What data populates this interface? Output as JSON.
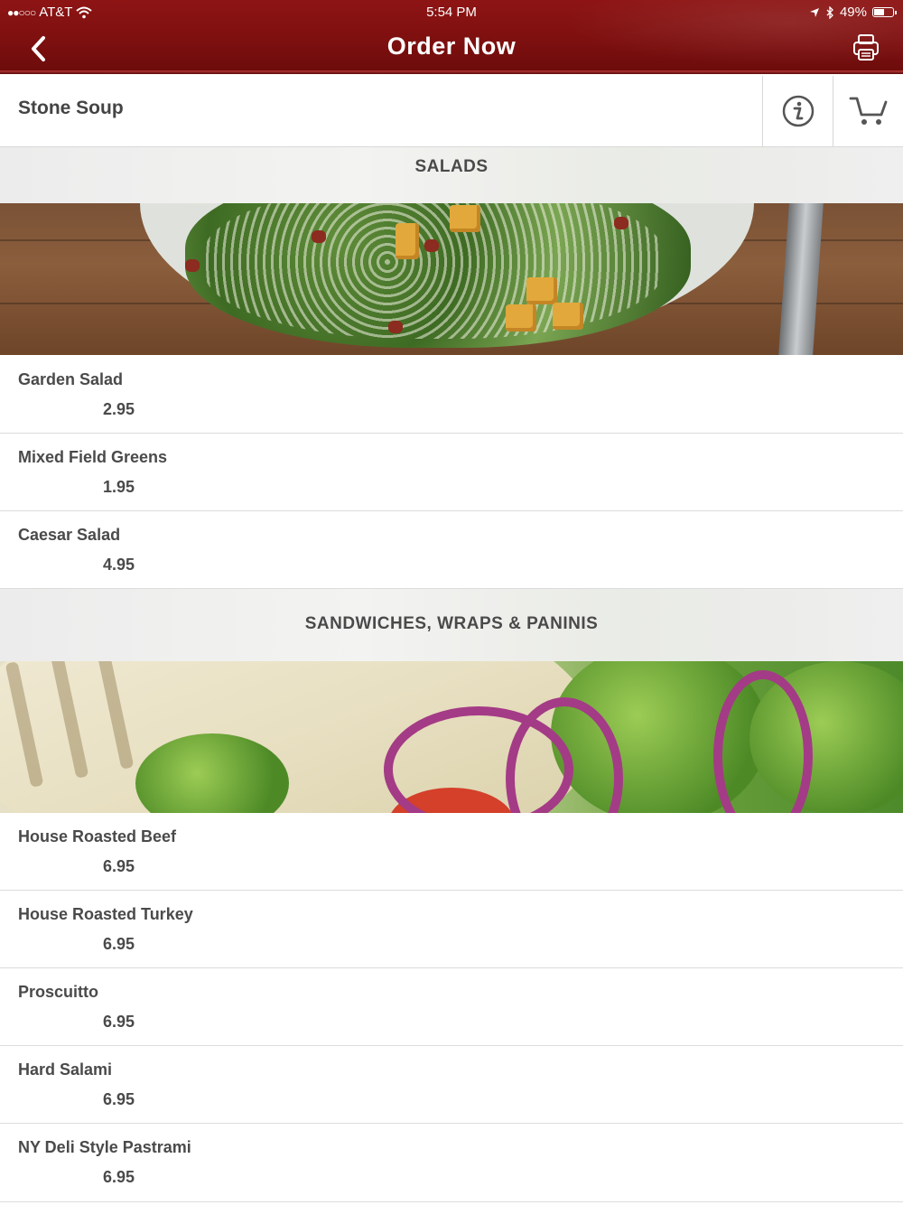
{
  "status_bar": {
    "carrier": "AT&T",
    "signal": "●●○○○",
    "time": "5:54 PM",
    "battery": "49%"
  },
  "header": {
    "title": "Order Now",
    "back_icon": "chevron-left-icon",
    "print_icon": "printer-icon",
    "color": "#7c0f0f"
  },
  "restaurant": {
    "name": "Stone Soup",
    "info_icon": "info-icon",
    "cart_icon": "cart-icon"
  },
  "sections": [
    {
      "title": "SALADS",
      "items": [
        {
          "name": "Garden Salad",
          "price": "2.95"
        },
        {
          "name": "Mixed Field Greens",
          "price": "1.95"
        },
        {
          "name": "Caesar Salad",
          "price": "4.95"
        }
      ]
    },
    {
      "title": "SANDWICHES, WRAPS & PANINIS",
      "items": [
        {
          "name": "House Roasted Beef",
          "price": "6.95"
        },
        {
          "name": "House Roasted Turkey",
          "price": "6.95"
        },
        {
          "name": "Proscuitto",
          "price": "6.95"
        },
        {
          "name": "Hard Salami",
          "price": "6.95"
        },
        {
          "name": "NY Deli Style Pastrami",
          "price": "6.95"
        }
      ]
    }
  ]
}
